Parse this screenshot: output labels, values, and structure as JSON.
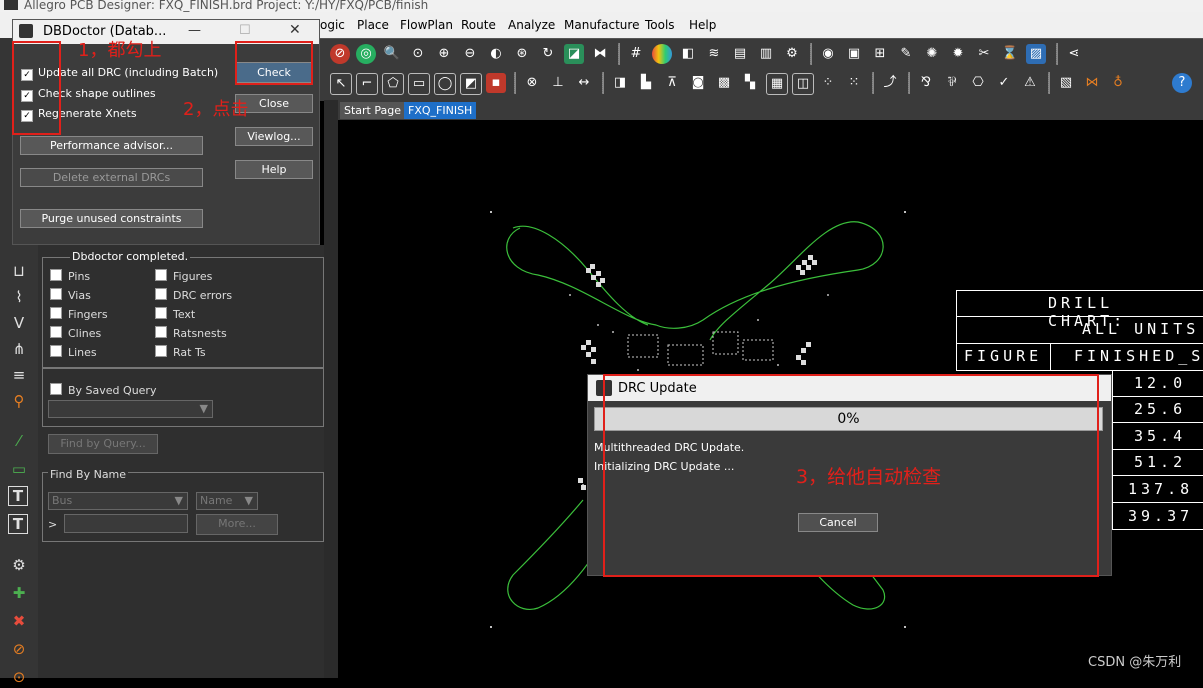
{
  "app": {
    "title": "Allegro PCB Designer: FXQ_FINISH.brd  Project: Y:/HY/FXQ/PCB/finish"
  },
  "menu": {
    "items": [
      "ogic",
      "Place",
      "FlowPlan",
      "Route",
      "Analyze",
      "Manufacture",
      "Tools",
      "Help"
    ]
  },
  "tabs": {
    "start": "Start Page",
    "active": "FXQ_FINISH"
  },
  "dbdoctor": {
    "title": "DBDoctor (Datab...",
    "win_min": "—",
    "win_max": "☐",
    "win_close": "✕",
    "options": [
      "Update all DRC (including Batch)",
      "Check shape outlines",
      "Regenerate Xnets"
    ],
    "check_label": "Check",
    "close_label": "Close",
    "viewlog_label": "Viewlog...",
    "help_label": "Help",
    "performance_label": "Performance advisor...",
    "delete_drc_label": "Delete external DRCs",
    "purge_label": "Purge unused constraints",
    "status": "Dbdoctor completed."
  },
  "find": {
    "left_items": [
      "Pins",
      "Vias",
      "Fingers",
      "Clines",
      "Lines"
    ],
    "right_items": [
      "Figures",
      "DRC errors",
      "Text",
      "Ratsnests",
      "Rat Ts"
    ],
    "saved_query_label": "By Saved Query",
    "find_query_label": "Find by Query...",
    "find_by_name_label": "Find By Name",
    "type_value": "Bus",
    "name_value": "Name",
    "prefix": ">",
    "more_label": "More..."
  },
  "drc": {
    "title": "DRC Update",
    "progress_text": "0%",
    "progress": 0,
    "line1": "Multithreaded DRC Update.",
    "line2": "Initializing DRC Update ...",
    "cancel_label": "Cancel"
  },
  "drill_chart": {
    "title": "DRILL  CHART:",
    "units": "ALL  UNITS",
    "col_figure": "FIGURE",
    "col_finished": "FINISHED_S",
    "values": [
      "12.0",
      "25.6",
      "35.4",
      "51.2",
      "137.8",
      "39.37"
    ]
  },
  "annotations": {
    "step1": "1，都勾上",
    "step2": "2，点击",
    "step3": "3，给他自动检查"
  },
  "watermark": "CSDN @朱万利",
  "colors": {
    "accent_red": "#e0201a",
    "board_outline": "#3bbf3b",
    "tab_active": "#1e6fc8"
  }
}
